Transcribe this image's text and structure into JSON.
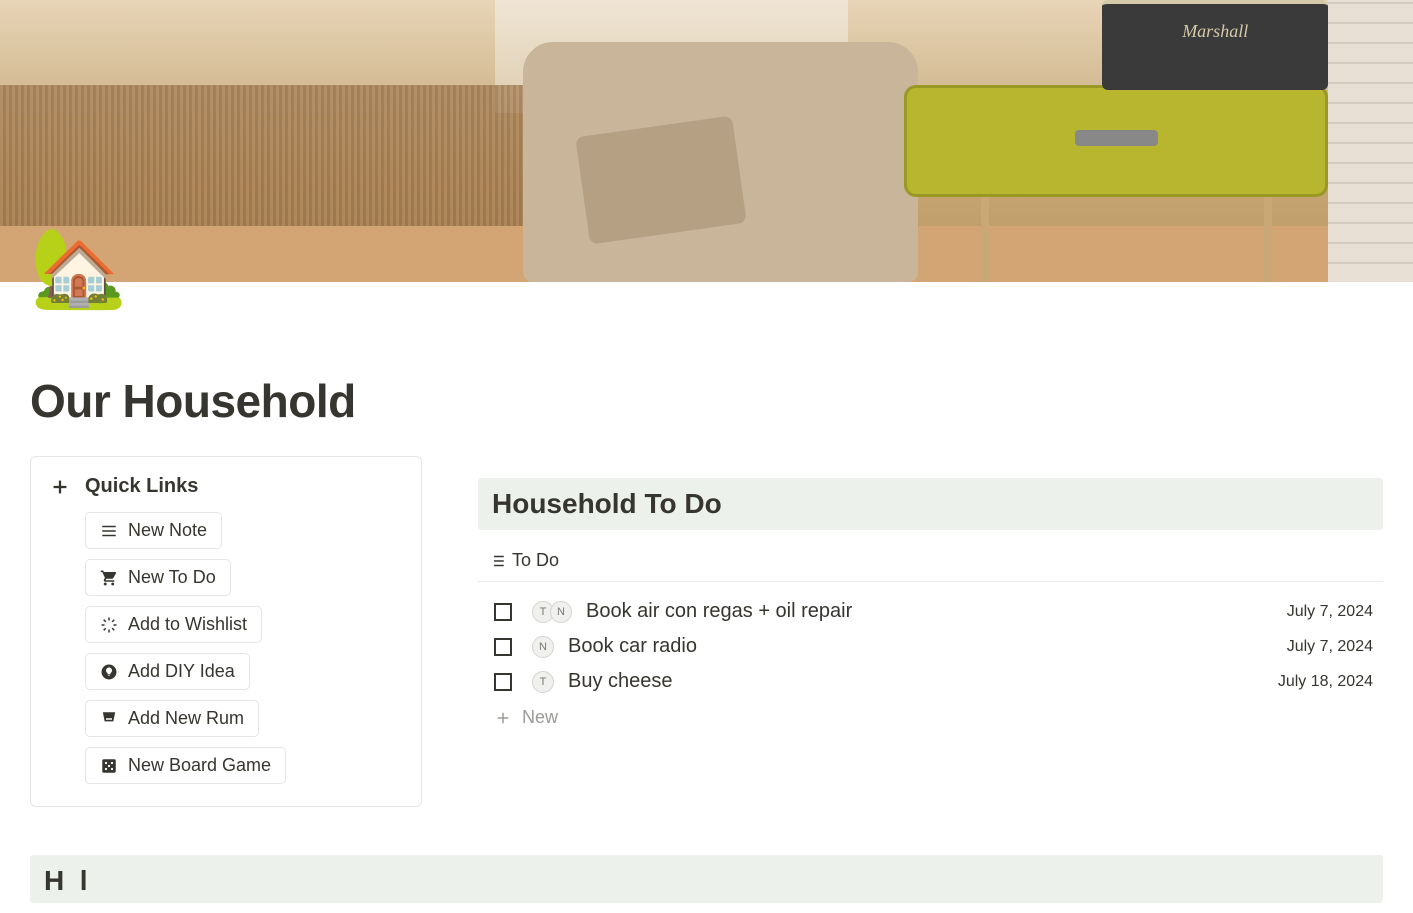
{
  "page": {
    "icon": "🏡",
    "title": "Our Household"
  },
  "quick_links": {
    "header": "Quick Links",
    "buttons": [
      {
        "label": "New Note",
        "icon": "list"
      },
      {
        "label": "New To Do",
        "icon": "cart"
      },
      {
        "label": "Add to Wishlist",
        "icon": "sparkle"
      },
      {
        "label": "Add DIY Idea",
        "icon": "bulb"
      },
      {
        "label": "Add New Rum",
        "icon": "glass"
      },
      {
        "label": "New Board Game",
        "icon": "dice"
      }
    ]
  },
  "todo_section": {
    "title": "Household To Do",
    "view_label": "To Do",
    "items": [
      {
        "title": "Book air con regas + oil repair",
        "date": "July 7, 2024",
        "avatars": [
          "T",
          "N"
        ]
      },
      {
        "title": "Book car radio",
        "date": "July 7, 2024",
        "avatars": [
          "N"
        ]
      },
      {
        "title": "Buy cheese",
        "date": "July 18, 2024",
        "avatars": [
          "T"
        ]
      }
    ],
    "new_label": "New"
  },
  "partial_section": {
    "visible_text": "H  l"
  }
}
